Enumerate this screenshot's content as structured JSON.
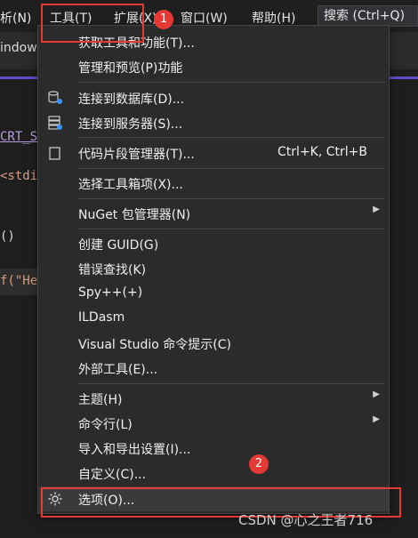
{
  "menubar": {
    "items": [
      "析(N)",
      "工具(T)",
      "扩展(X)",
      "窗口(W)",
      "帮助(H)"
    ],
    "search": "搜索 (Ctrl+Q)"
  },
  "editor": {
    "tab_fragment": "indows",
    "code_lines": [
      "CRT_S",
      "<stdi",
      "()",
      "f(\"He"
    ]
  },
  "menu": {
    "items": [
      {
        "label": "获取工具和功能(T)..."
      },
      {
        "label": "管理和预览(P)功能"
      },
      {
        "label": "连接到数据库(D)...",
        "icon": "database-connect-icon"
      },
      {
        "label": "连接到服务器(S)...",
        "icon": "server-connect-icon"
      },
      {
        "label": "代码片段管理器(T)...",
        "shortcut": "Ctrl+K, Ctrl+B",
        "icon": "snippet-icon"
      },
      {
        "label": "选择工具箱项(X)..."
      },
      {
        "label": "NuGet 包管理器(N)",
        "submenu": true
      },
      {
        "label": "创建 GUID(G)"
      },
      {
        "label": "错误查找(K)"
      },
      {
        "label": "Spy++(+)"
      },
      {
        "label": "ILDasm"
      },
      {
        "label": "Visual Studio 命令提示(C)"
      },
      {
        "label": "外部工具(E)..."
      },
      {
        "label": "主题(H)",
        "submenu": true
      },
      {
        "label": "命令行(L)",
        "submenu": true
      },
      {
        "label": "导入和导出设置(I)..."
      },
      {
        "label": "自定义(C)..."
      },
      {
        "label": "选项(O)...",
        "icon": "gear-icon"
      }
    ]
  },
  "annotations": {
    "badge1": "1",
    "badge2": "2"
  },
  "watermark": "CSDN @心之王者716",
  "colors": {
    "annotation_red": "#e53935",
    "menu_bg": "#2b2b2b",
    "accent": "#5f4ec8"
  }
}
